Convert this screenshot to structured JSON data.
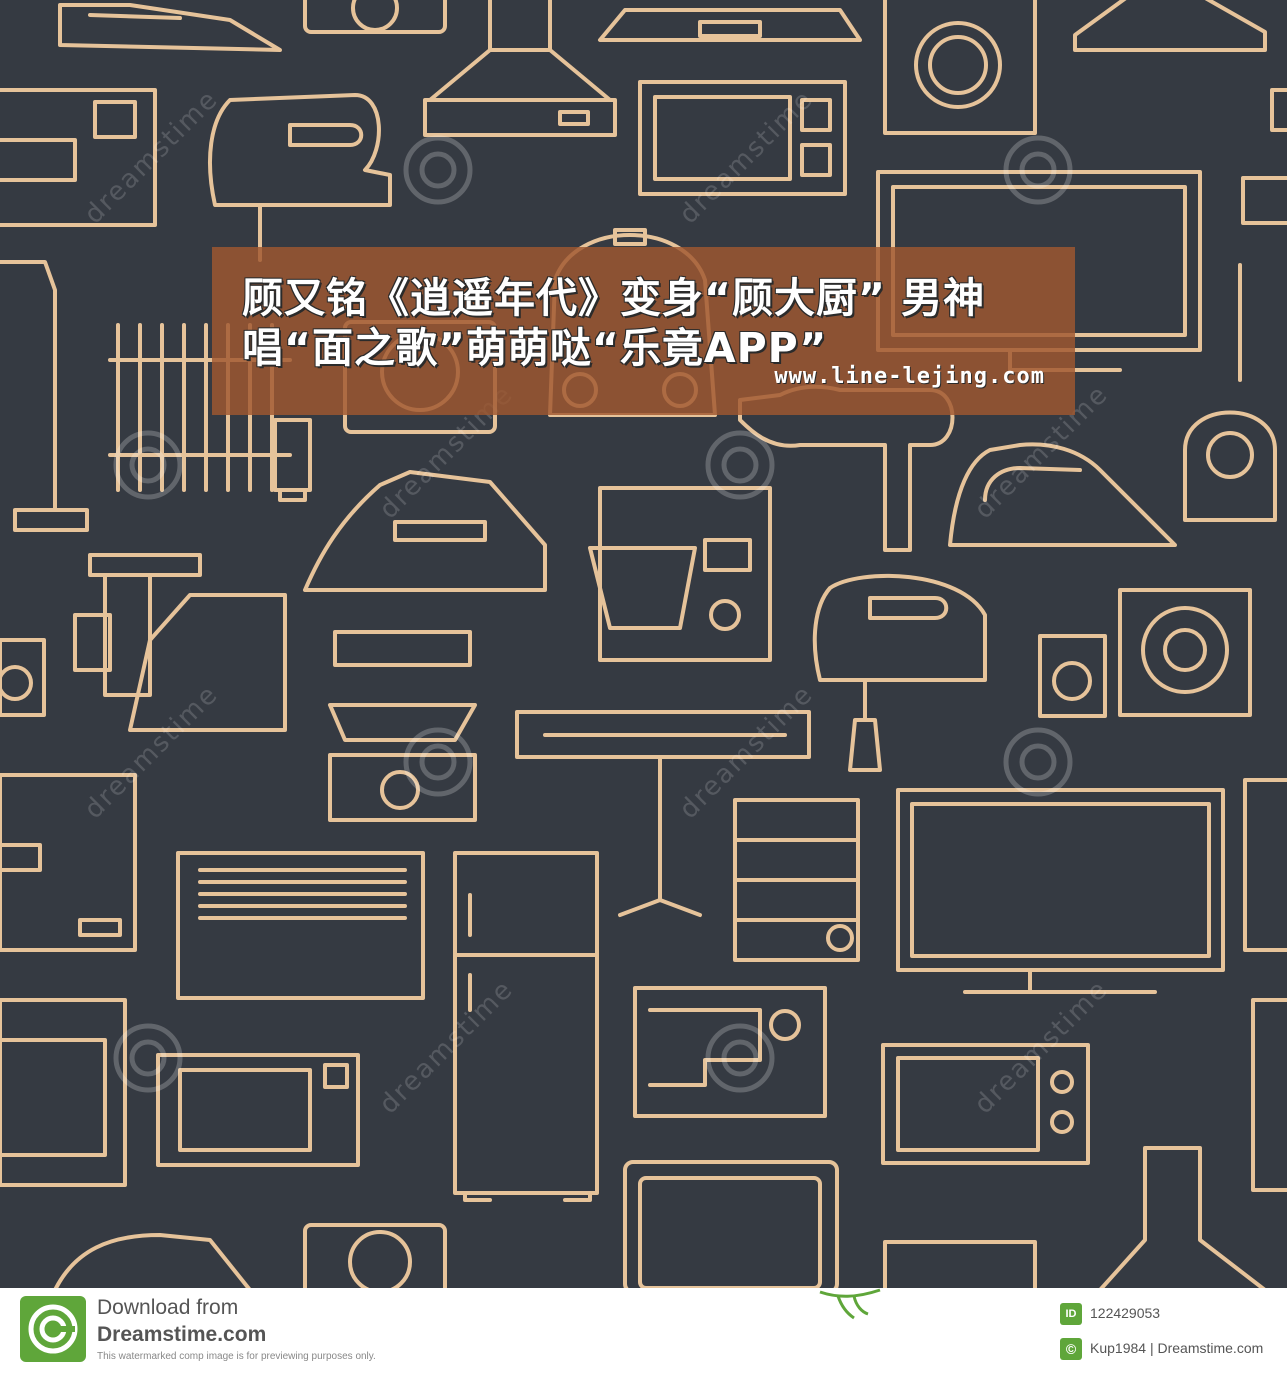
{
  "banner": {
    "headline": "顾又铭《逍遥年代》变身“顾大厨” 男神 唱“面之歌”萌萌哒“乐竟APP”",
    "url": "www.line-lejing.com",
    "color": "#a05830"
  },
  "watermark": {
    "text": "dreamstime"
  },
  "footer": {
    "line1": "Download from",
    "line2": "Dreamstime.com",
    "note": "This watermarked comp image is for previewing purposes only.",
    "id_label": "ID",
    "image_id": "122429053",
    "copyright_symbol": "©",
    "author": "Kup1984 | Dreamstime.com",
    "accent": "#5fa63a"
  },
  "pattern": {
    "line_color": "#e6c39a",
    "background": "#353a42",
    "icons": [
      "iron-icon",
      "range-hood-icon",
      "washing-machine-icon",
      "microwave-icon",
      "tv-icon",
      "mixer-icon",
      "radiator-icon",
      "heater-icon",
      "hair-dryer-icon",
      "vacuum-cleaner-icon",
      "meat-grinder-icon",
      "steamer-icon",
      "stand-mixer-icon",
      "speaker-icon",
      "air-conditioner-icon",
      "fridge-icon",
      "sewing-machine-icon",
      "oven-icon",
      "camera-icon"
    ]
  }
}
